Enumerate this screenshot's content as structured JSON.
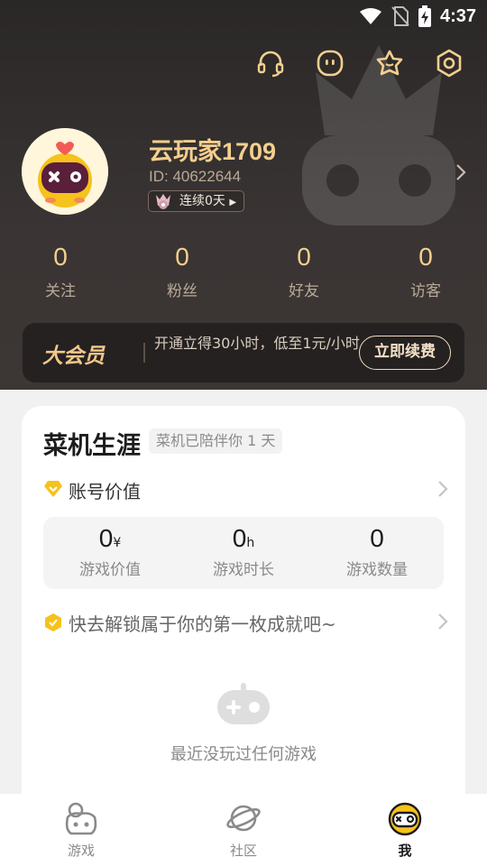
{
  "status_bar": {
    "time": "4:37"
  },
  "profile": {
    "username": "云玩家1709",
    "id_text": "ID: 40622644",
    "streak_label": "连续0天"
  },
  "stats": [
    {
      "value": "0",
      "label": "关注"
    },
    {
      "value": "0",
      "label": "粉丝"
    },
    {
      "value": "0",
      "label": "好友"
    },
    {
      "value": "0",
      "label": "访客"
    }
  ],
  "vip": {
    "logo_text": "大会员",
    "promo_text": "开通立得30小时，低至1元/小时",
    "button_label": "立即续费"
  },
  "career": {
    "title": "菜机生涯",
    "companion_tag": "菜机已陪伴你 1 天",
    "account_value_label": "账号价值",
    "metrics": [
      {
        "value": "0",
        "unit": "¥",
        "label": "游戏价值"
      },
      {
        "value": "0",
        "unit": "h",
        "label": "游戏时长"
      },
      {
        "value": "0",
        "unit": "",
        "label": "游戏数量"
      }
    ],
    "achievement_label": "快去解锁属于你的第一枚成就吧~",
    "empty_text": "最近没玩过任何游戏"
  },
  "bottom_nav": [
    {
      "label": "游戏",
      "active": false
    },
    {
      "label": "社区",
      "active": false
    },
    {
      "label": "我",
      "active": true
    }
  ],
  "colors": {
    "header_bg": "#3a3534",
    "gold_text": "#f4cf8e",
    "muted_text": "#b9aa98",
    "card_bg": "#ffffff",
    "accent_yellow": "#f5c21c"
  }
}
